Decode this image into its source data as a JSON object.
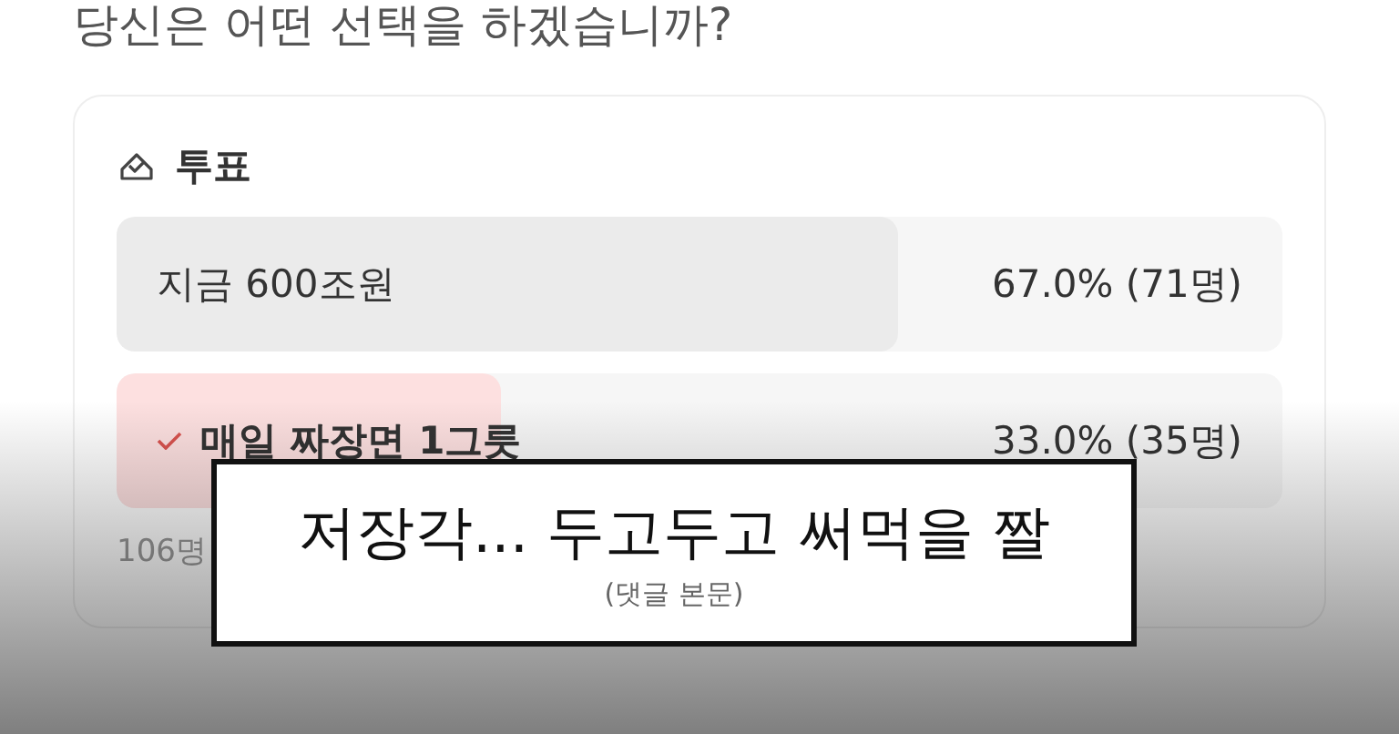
{
  "question": "당신은 어떤 선택을 하겠습니까?",
  "poll": {
    "title": "투표",
    "options": [
      {
        "label": "지금 600조원",
        "result": "67.0% (71명)",
        "level": 0.67,
        "selected": false
      },
      {
        "label": "매일 짜장면 1그릇",
        "result": "33.0% (35명)",
        "level": 0.33,
        "selected": true
      }
    ],
    "footer": "106명"
  },
  "caption": {
    "text": "저장각... 두고두고 써먹을 짤",
    "source": "(댓글 본문)"
  }
}
